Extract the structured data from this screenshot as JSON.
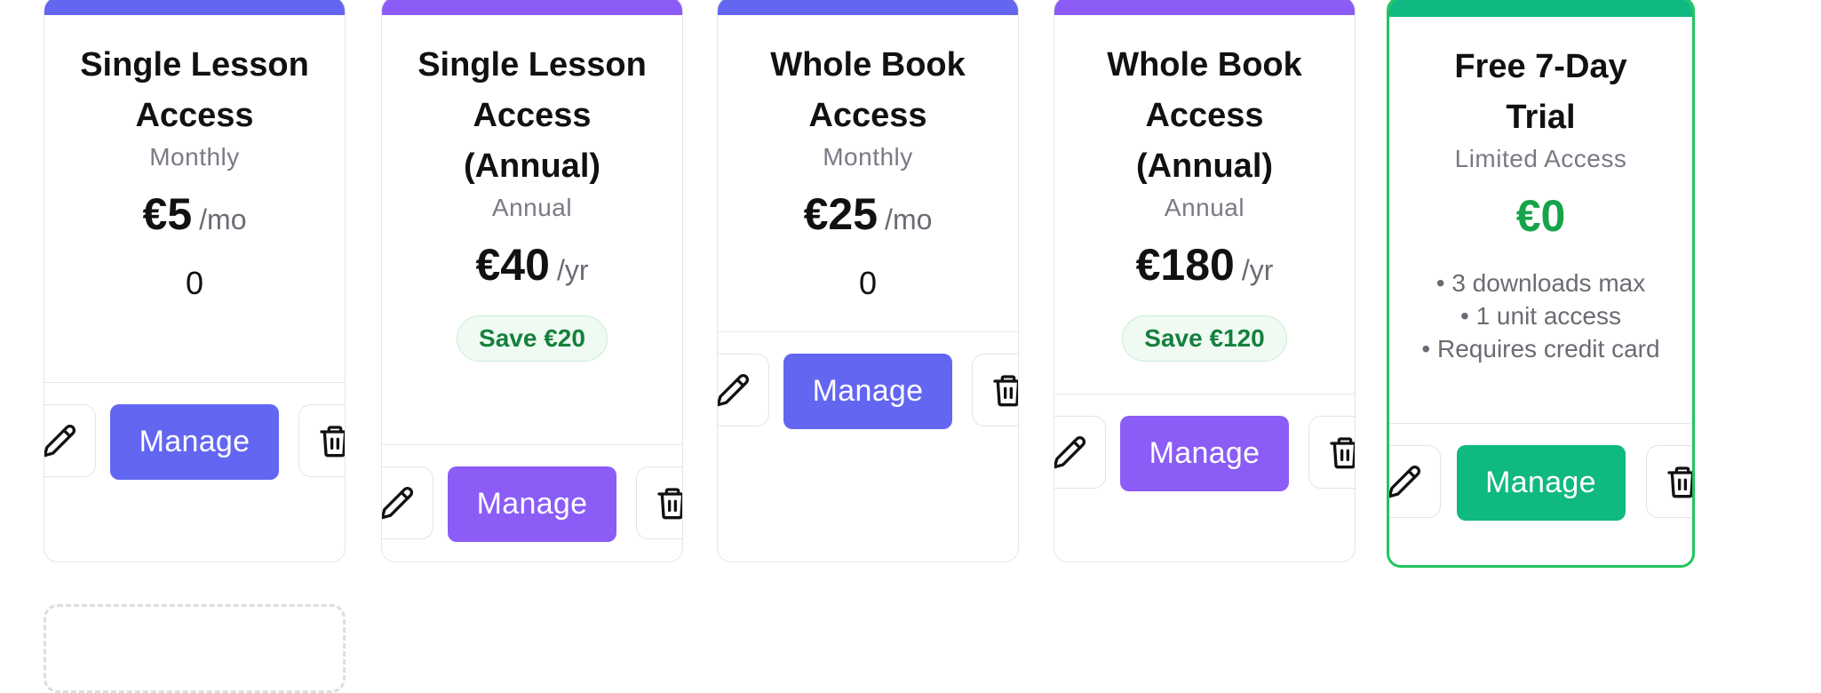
{
  "colors": {
    "indigo": "#6366f1",
    "violet": "#8b5cf6",
    "emerald": "#10b981",
    "trial_border": "#22c55e",
    "trial_price": "#16a34a",
    "save_text": "#15803d"
  },
  "actions": {
    "manage_label": "Manage",
    "edit_icon": "pencil-icon",
    "delete_icon": "trash-icon"
  },
  "plans": [
    {
      "title": "Single Lesson Access",
      "period": "Monthly",
      "price": "€5",
      "unit": "/mo",
      "count": "0",
      "accent": "#6366f1"
    },
    {
      "title": "Single Lesson Access (Annual)",
      "period": "Annual",
      "price": "€40",
      "unit": "/yr",
      "save": "Save €20",
      "accent": "#8b5cf6"
    },
    {
      "title": "Whole Book Access",
      "period": "Monthly",
      "price": "€25",
      "unit": "/mo",
      "count": "0",
      "accent": "#6366f1"
    },
    {
      "title": "Whole Book Access (Annual)",
      "period": "Annual",
      "price": "€180",
      "unit": "/yr",
      "save": "Save €120",
      "accent": "#8b5cf6"
    },
    {
      "title": "Free 7-Day Trial",
      "period": "Limited Access",
      "price": "€0",
      "features": [
        "• 3 downloads max",
        "• 1 unit access",
        "• Requires credit card"
      ],
      "accent": "#10b981"
    }
  ]
}
